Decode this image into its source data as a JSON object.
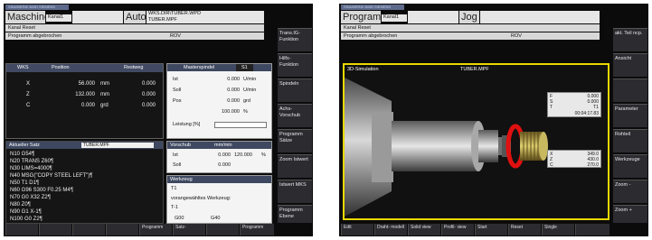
{
  "screen1": {
    "title_bar": "SINUMERIK 840D SIEMENS",
    "header": {
      "mode": "Maschine",
      "channel": "Kanal1",
      "op_mode": "Auto",
      "program_path": "WKS.DIR\\TUBER.WPD",
      "program_name": "TUBER.MPF"
    },
    "status_line1": "Kanal Reset",
    "status_line2": "Programm abgebrochen",
    "rov": "ROV",
    "wcs_table": {
      "headers": [
        "WKS",
        "Position",
        "",
        "Restweg"
      ],
      "rows": [
        {
          "axis": "X",
          "pos": "56.000",
          "unit": "mm",
          "rest": "0.000"
        },
        {
          "axis": "Z",
          "pos": "132.000",
          "unit": "mm",
          "rest": "0.000"
        },
        {
          "axis": "C",
          "pos": "0.000",
          "unit": "grd",
          "rest": "0.000"
        }
      ]
    },
    "spindle": {
      "title": "Masterspindel",
      "index": "S1",
      "rows": [
        {
          "label": "Ist",
          "value": "0.000",
          "unit": "U/min"
        },
        {
          "label": "Soll",
          "value": "0.000",
          "unit": "U/min"
        },
        {
          "label": "Pos",
          "value": "0.000",
          "unit": "grd"
        },
        {
          "label": "",
          "value": "100.000",
          "unit": "%"
        }
      ],
      "power_label": "Leistung [%]"
    },
    "block": {
      "title": "Aktueller Satz",
      "program": "TUBER.MPF",
      "lines": [
        "N10 G54¶",
        "N20 TRANS Z60¶",
        "N30 LIMS=4000¶",
        "N40 MSG(\"COPY STEEL LEFT\")¶",
        "N50 T1 D1¶",
        "N60 G96 S300 F0.25 M4¶",
        "N70 G0 X32 Z2¶",
        "N80 Z0¶",
        "N90 G1 X-1¶",
        "N100 G0 Z2¶"
      ]
    },
    "feed": {
      "title": "Vorschub",
      "unit": "mm/min",
      "rows": [
        {
          "label": "Ist",
          "value": "0.000",
          "pct": "120.000",
          "unit": "%"
        },
        {
          "label": "Soll",
          "value": "0.000",
          "pct": "",
          "unit": ""
        }
      ]
    },
    "tool": {
      "title": "Werkzeug",
      "current": "T1",
      "preselected_label": "vorangewähltes Werkzeug:",
      "preselected": "T-1",
      "g_codes": [
        "G00",
        "G40"
      ]
    },
    "softkeys_right": [
      "Trans.IG- Funktion",
      "Hilfs- Funktion",
      "Spindeln",
      "Achs- Vorschub",
      "Programm Sätze",
      "Zoom Istwert",
      "Istwert MKS",
      "Programm Ebene"
    ],
    "softkeys_bottom": [
      "",
      "",
      "",
      "",
      "Programm",
      "Satz-",
      "",
      "Programm"
    ]
  },
  "screen2": {
    "title_bar": "SINUMERIK 840D SIEMENS",
    "header": {
      "mode": "Programm",
      "channel": "Kanal1",
      "op_mode": "Jog"
    },
    "status_line1": "Kanal Reset",
    "status_line2": "Programm abgebrochen",
    "rov": "ROV",
    "sim_title": "3D-Simulation",
    "sim_program": "TUBER.MPF",
    "readout_top": [
      {
        "label": "F",
        "value": "0.000"
      },
      {
        "label": "S",
        "value": "0.000"
      },
      {
        "label": "T",
        "value": "T1"
      },
      {
        "label": "",
        "value": "00:04:17.83"
      }
    ],
    "readout_bottom": [
      {
        "label": "X",
        "value": "349.0"
      },
      {
        "label": "Z",
        "value": "430.0"
      },
      {
        "label": "C",
        "value": "270.0"
      }
    ],
    "softkeys_right": [
      "akt. Teil ncp.",
      "Ansicht",
      "",
      "Parameter",
      "Rohteil",
      "Werkzeuge",
      "Zoom -",
      "Zoom +"
    ],
    "softkeys_bottom": [
      "Edit",
      "Draht- modell",
      "Solid view",
      "Profil- view",
      "Start",
      "Reset",
      "Single",
      ""
    ]
  }
}
